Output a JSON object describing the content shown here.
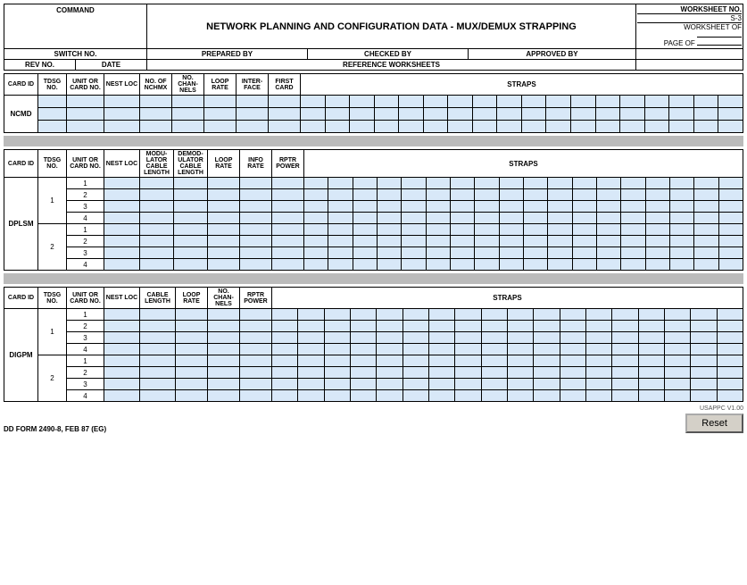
{
  "header": {
    "command_label": "COMMAND",
    "title": "NETWORK PLANNING AND CONFIGURATION DATA - MUX/DEMUX  STRAPPING",
    "worksheet_no_label": "WORKSHEET NO.",
    "worksheet_no_value": "S-3",
    "worksheet_label": "WORKSHEET",
    "of_label": "OF",
    "page_label": "PAGE",
    "of2_label": "OF"
  },
  "row2": {
    "switch_no_label": "SWITCH NO.",
    "prepared_by_label": "PREPARED BY",
    "checked_by_label": "CHECKED BY",
    "approved_by_label": "APPROVED BY"
  },
  "row3": {
    "rev_no_label": "REV NO.",
    "date_label": "DATE",
    "reference_worksheets_label": "REFERENCE WORKSHEETS"
  },
  "section1": {
    "col_headers": [
      "CARD ID",
      "TDSG\nNO.",
      "UNIT OR\nCARD NO.",
      "NEST LOC",
      "NO. OF\nNCHMX",
      "NO.\nCHAN-\nNELS",
      "LOOP\nRATE",
      "INTER-\nFACE",
      "FIRST\nCARD",
      "STRAPS"
    ],
    "row_label": "NCMD",
    "rows": [
      [
        "",
        "",
        "",
        "",
        "",
        "",
        "",
        "",
        ""
      ],
      [
        "",
        "",
        "",
        "",
        "",
        "",
        "",
        "",
        ""
      ],
      [
        "",
        "",
        "",
        "",
        "",
        "",
        "",
        "",
        ""
      ]
    ]
  },
  "section2": {
    "col_headers": [
      "CARD ID",
      "TDSG\nNO.",
      "UNIT OR\nCARD NO.",
      "NEST LOC",
      "MODU-\nLATOR\nCABLE\nLENGTH",
      "DEMOD-\nULATOR\nCABLE\nLENGTH",
      "LOOP\nRATE",
      "INFO\nRATE",
      "RPTR\nPOWER",
      "STRAPS"
    ],
    "row_label": "DPLSM",
    "groups": [
      {
        "group_no": "1",
        "rows": [
          "1",
          "2",
          "3",
          "4"
        ]
      },
      {
        "group_no": "2",
        "rows": [
          "1",
          "2",
          "3",
          "4"
        ]
      }
    ]
  },
  "section3": {
    "col_headers": [
      "CARD ID",
      "TDSG\nNO.",
      "UNIT OR\nCARD NO.",
      "NEST LOC",
      "CABLE\nLENGTH",
      "LOOP\nRATE",
      "NO.\nCHAN-\nNELS",
      "RPTR\nPOWER",
      "STRAPS"
    ],
    "row_label": "DIGPM",
    "groups": [
      {
        "group_no": "1",
        "rows": [
          "1",
          "2",
          "3",
          "4"
        ]
      },
      {
        "group_no": "2",
        "rows": [
          "1",
          "2",
          "3",
          "4"
        ]
      }
    ]
  },
  "footer": {
    "form_label": "DD FORM 2490-8, FEB 87 (EG)",
    "version": "USAPPC V1.00",
    "reset_label": "Reset"
  }
}
